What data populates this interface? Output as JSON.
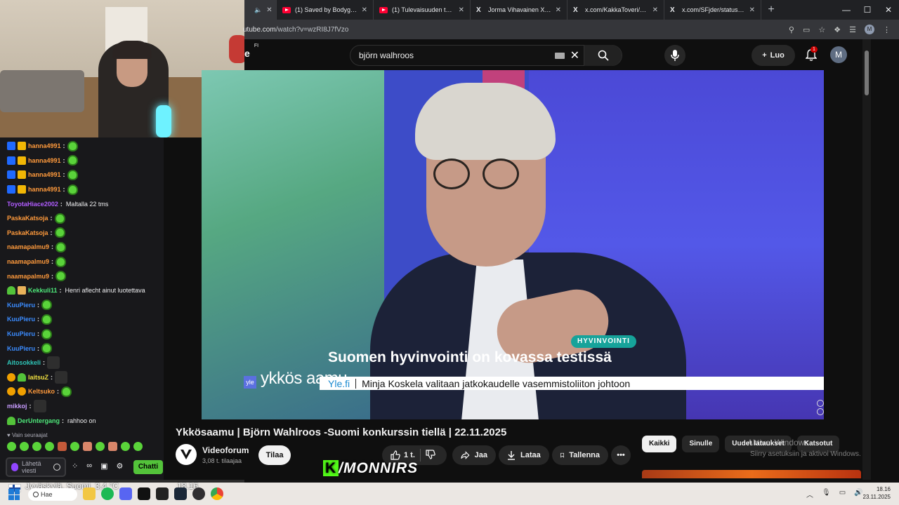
{
  "browser": {
    "tabs": [
      {
        "title": "m",
        "favicon": "youtube"
      },
      {
        "title": "(1) Saved by Bodyguards",
        "favicon": "youtube"
      },
      {
        "title": "(1) Tulevaisuuden tavoite",
        "favicon": "youtube"
      },
      {
        "title": "Jorma Vihavainen Xssä: \"",
        "favicon": "x"
      },
      {
        "title": "x.com/KakkaToveri/status",
        "favicon": "x"
      },
      {
        "title": "x.com/SFjder/status/1990",
        "favicon": "x"
      }
    ],
    "new_tab": "+",
    "url_prefix": "utube.com",
    "url_path": "/watch?v=wzRI8J7fVzo",
    "profile_initial": "M"
  },
  "youtube": {
    "logo_text": "e",
    "logo_region": "FI",
    "search_value": "björn walhroos",
    "create_label": "Luo",
    "notification_count": "1",
    "avatar_initial": "M",
    "video_title": "Ykkösaamu | Björn Wahlroos -Suomi konkurssin tiellä | 22.11.2025",
    "channel_name": "Videoforum",
    "channel_subs": "3,08 t. tilaajaa",
    "subscribe_label": "Tilaa",
    "like_count": "1 t.",
    "share_label": "Jaa",
    "download_label": "Lataa",
    "save_label": "Tallenna",
    "chips": [
      "Kaikki",
      "Sinulle",
      "Uudet lataukset",
      "Katsotut"
    ],
    "active_chip": "Kaikki"
  },
  "video_overlay": {
    "tag": "HYVINVOINTI",
    "headline": "Suomen hyvinvointi on kovassa testissä",
    "ticker_source": "Yle.fi",
    "ticker_text": "Minja Koskela valitaan jatkokaudelle vasemmistoliiton johtoon",
    "program_logo": "ykkös aamu",
    "channel_logo": "yle"
  },
  "windows_activation": {
    "line1": "Aktivoi Windows",
    "line2": "Siirry asetuksiin ja aktivoi Windows."
  },
  "stream_watermark": {
    "k": "K",
    "text": "/MONNIRS"
  },
  "chat": {
    "messages": [
      {
        "user": "hanna4991",
        "color": "#ff9a3c",
        "badges": [
          "prime",
          "crown"
        ],
        "text": "",
        "emote": "green"
      },
      {
        "user": "hanna4991",
        "color": "#ff9a3c",
        "badges": [
          "prime",
          "crown"
        ],
        "text": "",
        "emote": "green"
      },
      {
        "user": "hanna4991",
        "color": "#ff9a3c",
        "badges": [
          "prime",
          "crown"
        ],
        "text": "",
        "emote": "green"
      },
      {
        "user": "hanna4991",
        "color": "#ff9a3c",
        "badges": [
          "prime",
          "crown"
        ],
        "text": "",
        "emote": "green"
      },
      {
        "user": "ToyotaHiace2002",
        "color": "#b05cff",
        "badges": [],
        "text": "Maltalla 22 tms",
        "emote": ""
      },
      {
        "user": "PaskaKatsoja",
        "color": "#ff9a3c",
        "badges": [],
        "text": "",
        "emote": "green"
      },
      {
        "user": "PaskaKatsoja",
        "color": "#ff9a3c",
        "badges": [],
        "text": "",
        "emote": "green"
      },
      {
        "user": "naamapalmu9",
        "color": "#ff9a3c",
        "badges": [],
        "text": "",
        "emote": "green"
      },
      {
        "user": "naamapalmu9",
        "color": "#ff9a3c",
        "badges": [],
        "text": "",
        "emote": "green"
      },
      {
        "user": "naamapalmu9",
        "color": "#ff9a3c",
        "badges": [],
        "text": "",
        "emote": "green"
      },
      {
        "user": "Kekkuli11",
        "color": "#4ee87a",
        "badges": [
          "gift",
          "sub"
        ],
        "text": "Henri aflecht ainut luotettava",
        "emote": ""
      },
      {
        "user": "KuuPieru",
        "color": "#3b8cff",
        "badges": [],
        "text": "",
        "emote": "green"
      },
      {
        "user": "KuuPieru",
        "color": "#3b8cff",
        "badges": [],
        "text": "",
        "emote": "green"
      },
      {
        "user": "KuuPieru",
        "color": "#3b8cff",
        "badges": [],
        "text": "",
        "emote": "green"
      },
      {
        "user": "KuuPieru",
        "color": "#3b8cff",
        "badges": [],
        "text": "",
        "emote": "green"
      },
      {
        "user": "Aitosokkeli",
        "color": "#2ec4b6",
        "badges": [],
        "text": "",
        "emote": "dark"
      },
      {
        "user": "laitsuZ",
        "color": "#f0e040",
        "badges": [
          "orange",
          "gift"
        ],
        "text": "",
        "emote": "dark"
      },
      {
        "user": "Keltsuko",
        "color": "#ff9a3c",
        "badges": [
          "orange",
          "orange"
        ],
        "text": "",
        "emote": "green"
      },
      {
        "user": "mikkoj",
        "color": "#c89cff",
        "badges": [],
        "text": "",
        "emote": "dark"
      },
      {
        "user": "DerUntergang",
        "color": "#4ee87a",
        "badges": [
          "gift"
        ],
        "text": "rahhoo on",
        "emote": ""
      }
    ],
    "followers_only": "Vain seuraajat",
    "input_placeholder": "Lähetä viesti",
    "send_label": "Chatti"
  },
  "taskbar": {
    "weather_location": "Jyväskylä, Suomi",
    "weather_temp": "3,4 °C",
    "weather_time": "18.16",
    "search_label": "Hae",
    "time": "18.16",
    "date": "23.11.2025"
  }
}
